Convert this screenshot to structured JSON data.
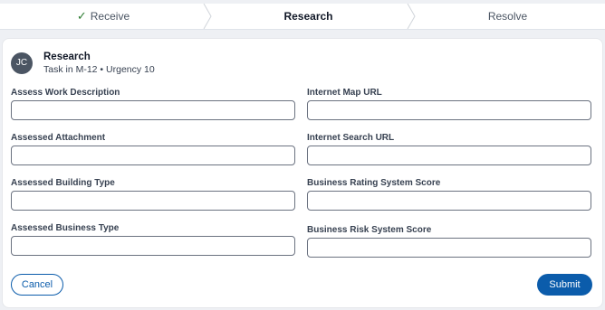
{
  "stepper": {
    "steps": [
      {
        "label": "Receive",
        "status": "complete"
      },
      {
        "label": "Research",
        "status": "current"
      },
      {
        "label": "Resolve",
        "status": "pending"
      }
    ]
  },
  "task": {
    "avatar_initials": "JC",
    "title": "Research",
    "subtitle": "Task in M-12 • Urgency 10"
  },
  "form": {
    "left": [
      {
        "label": "Assess Work Description",
        "value": ""
      },
      {
        "label": "Assessed Attachment",
        "value": ""
      },
      {
        "label": "Assessed Building Type",
        "value": ""
      },
      {
        "label": "Assessed Business Type",
        "value": ""
      }
    ],
    "right": [
      {
        "label": "Internet Map URL",
        "value": ""
      },
      {
        "label": "Internet Search URL",
        "value": ""
      },
      {
        "label": "Business Rating System Score",
        "value": ""
      },
      {
        "label": "Business Risk System Score",
        "value": ""
      }
    ]
  },
  "actions": {
    "cancel_label": "Cancel",
    "submit_label": "Submit"
  },
  "colors": {
    "accent": "#0b5cab",
    "check": "#2e7d32",
    "avatar_bg": "#4b5563"
  }
}
